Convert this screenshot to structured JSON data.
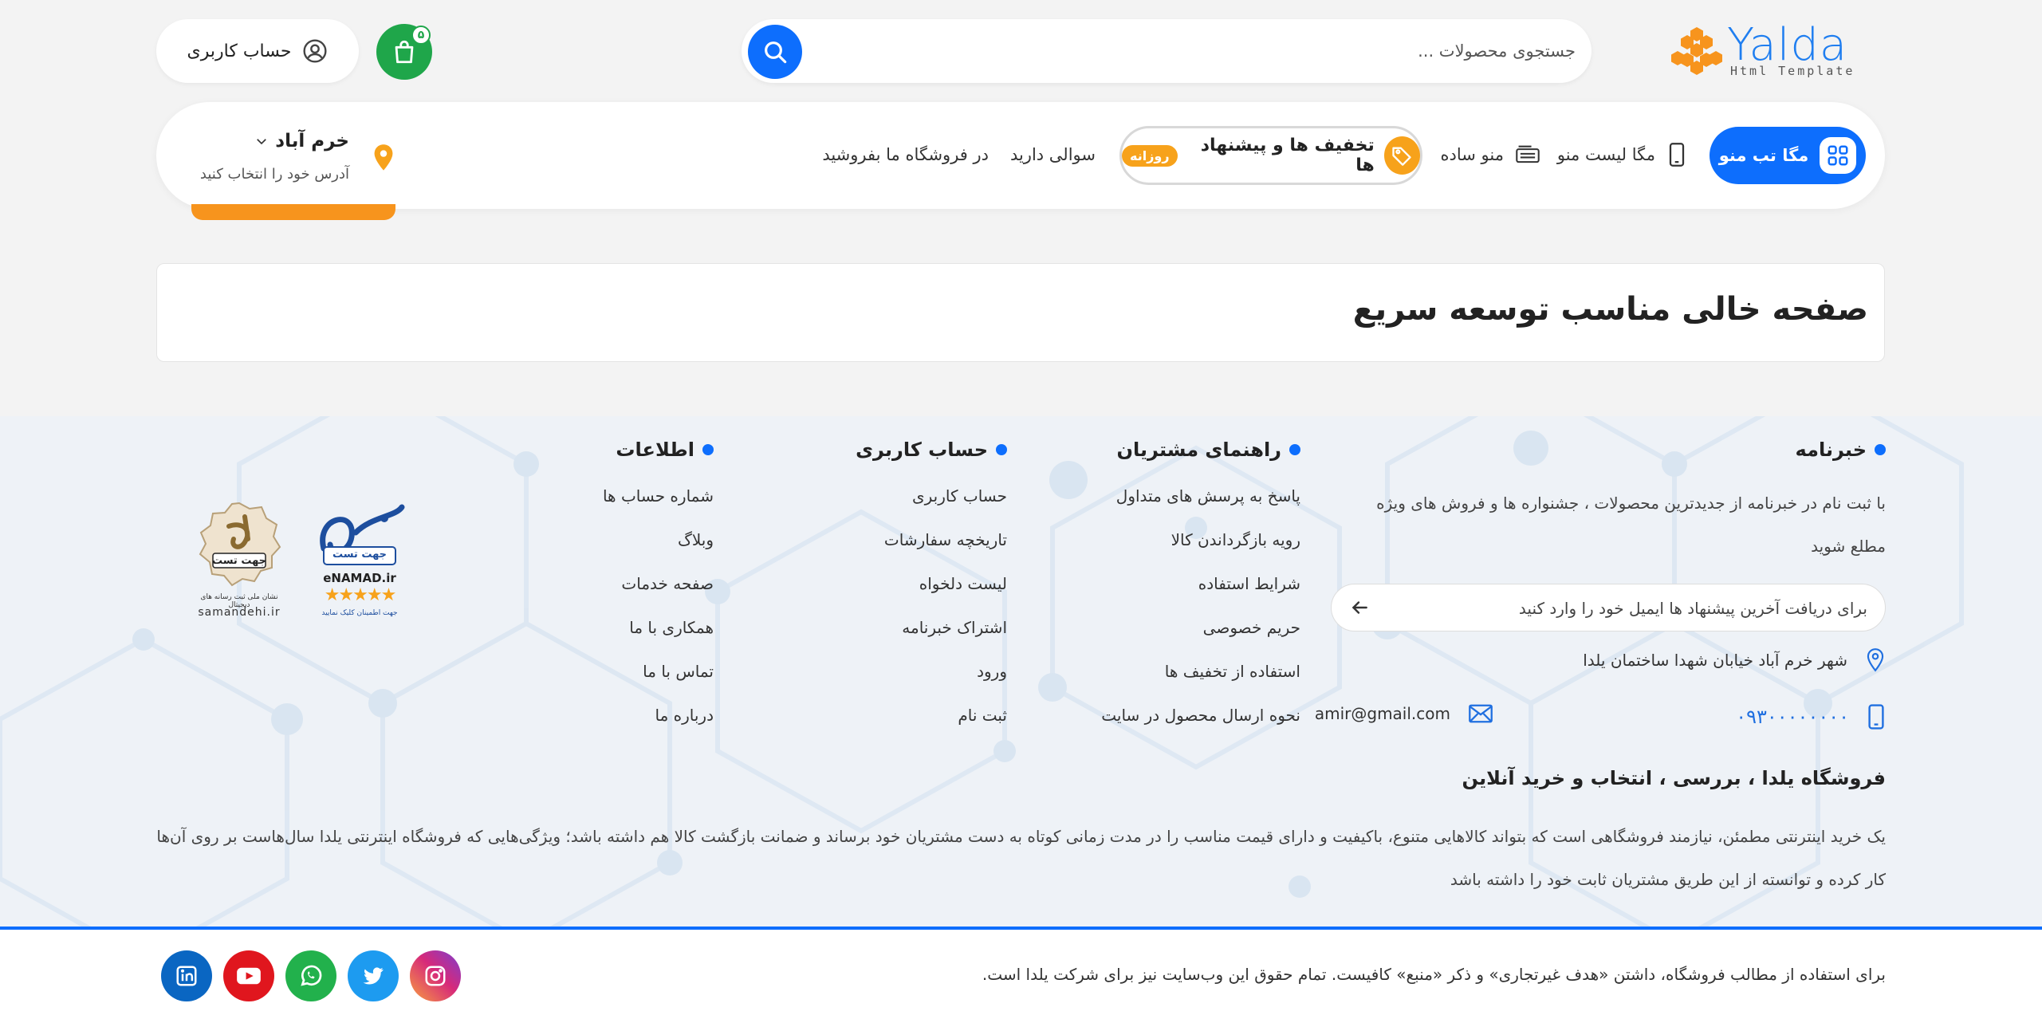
{
  "header": {
    "logo": {
      "word": "Yalda",
      "subtitle": "Html Template"
    },
    "search": {
      "placeholder": "جستجوی محصولات ..."
    },
    "cart": {
      "count": "۵"
    },
    "account": {
      "label": "حساب کاربری"
    }
  },
  "nav": {
    "mega_tab": "مگا تب منو",
    "mega_list": "مگا لیست منو",
    "simple_menu": "منو ساده",
    "deals": {
      "label": "تخفیف ها و پیشنهاد ها",
      "badge": "روزانه"
    },
    "question": "سوالی دارید",
    "sell": "در فروشگاه ما بفروشید",
    "location": {
      "city": "خرم آباد",
      "hint": "آدرس خود را انتخاب کنید"
    }
  },
  "page": {
    "title": "صفحه خالی مناسب توسعه سریع"
  },
  "footer": {
    "newsletter": {
      "title": "خبرنامه",
      "description": "با ثبت نام در خبرنامه از جدیدترین محصولات ، جشنواره ها و فروش های ویژه مطلع شوید",
      "placeholder": "برای دریافت آخرین پیشنهاد ها ایمیل خود را وارد کنید"
    },
    "address": "شهر خرم آباد خیابان شهدا ساختمان یلدا",
    "phone": "۰۹۳۰۰۰۰۰۰۰۰",
    "email": "amir@gmail.com",
    "customer_guide": {
      "title": "راهنمای مشتریان",
      "links": [
        "پاسخ به پرسش های متداول",
        "رویه بازگرداندن کالا",
        "شرایط استفاده",
        "حریم خصوصی",
        "استفاده از تخفیف ها",
        "نحوه ارسال محصول در سایت"
      ]
    },
    "user_account": {
      "title": "حساب کاربری",
      "links": [
        "حساب کاربری",
        "تاریخچه سفارشات",
        "لیست دلخواه",
        "اشتراک خبرنامه",
        "ورود",
        "ثبت نام"
      ]
    },
    "info": {
      "title": "اطلاعات",
      "links": [
        "شماره حساب ها",
        "وبلاگ",
        "صفحه خدمات",
        "همکاری با ما",
        "تماس با ما",
        "درباره ما"
      ]
    },
    "badges": {
      "enamad": {
        "top": "جهت تست",
        "name": "eNAMAD.ir",
        "caption": "جهت اطمینان کلیک نمایید"
      },
      "samandehi": {
        "label": "جهت تست",
        "caption": "نشان ملی ثبت رسانه های دیجیتال",
        "name": "samandehi.ir"
      }
    },
    "store": {
      "title": "فروشگاه یلدا ، بررسی ، انتخاب و خرید آنلاین",
      "description": "یک خرید اینترنتی مطمئن، نیازمند فروشگاهی است که بتواند کالاهایی متنوع، باکیفیت و دارای قیمت مناسب را در مدت زمانی کوتاه به دست مشتریان خود برساند و ضمانت بازگشت کالا هم داشته باشد؛ ویژگی‌هایی که فروشگاه اینترنتی یلدا سال‌هاست بر روی آن‌ها کار کرده و توانسته از این طریق مشتریان ثابت خود را داشته باشد"
    },
    "copyright": "برای استفاده از مطالب فروشگاه، داشتن «هدف غیرتجاری» و ذکر «منبع» کافیست. تمام حقوق این وب‌سایت نیز برای شرکت یلدا است."
  },
  "socials": [
    {
      "name": "linkedin-icon",
      "color": "#0a66c2"
    },
    {
      "name": "youtube-icon",
      "color": "#e0161e"
    },
    {
      "name": "whatsapp-icon",
      "color": "#22b14c"
    },
    {
      "name": "twitter-icon",
      "color": "#1d9bf0"
    },
    {
      "name": "instagram-icon",
      "color": "#d6297a"
    }
  ],
  "colors": {
    "primary": "#0d6efd",
    "accent": "#f7a21b",
    "cart": "#1fa64a"
  }
}
